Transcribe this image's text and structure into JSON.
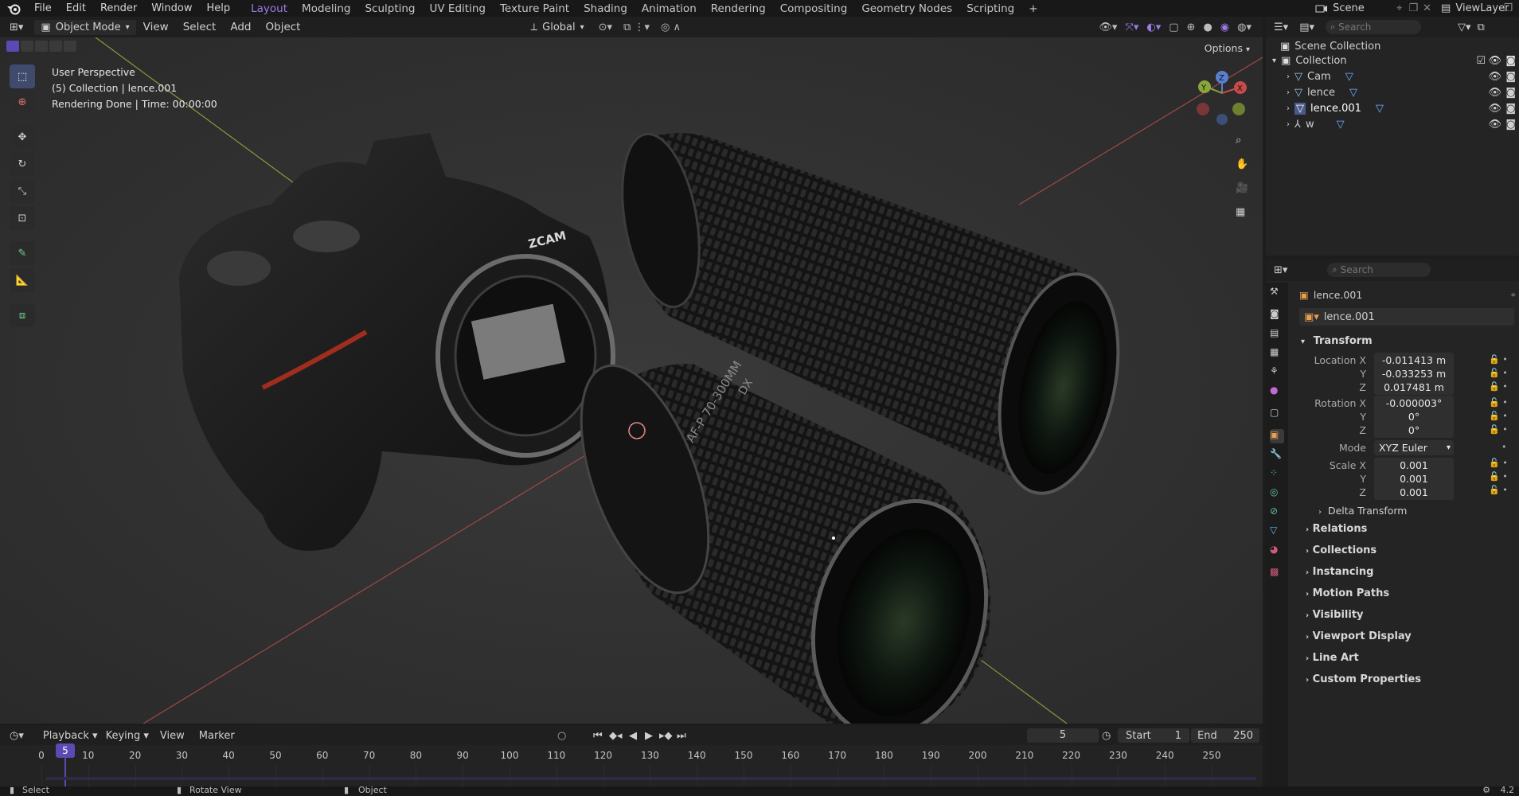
{
  "menu": [
    "File",
    "Edit",
    "Render",
    "Window",
    "Help"
  ],
  "workspaces": [
    "Layout",
    "Modeling",
    "Sculpting",
    "UV Editing",
    "Texture Paint",
    "Shading",
    "Animation",
    "Rendering",
    "Compositing",
    "Geometry Nodes",
    "Scripting",
    "+"
  ],
  "active_workspace": "Layout",
  "top_right": {
    "scene": "Scene",
    "view_layer": "ViewLayer"
  },
  "viewport_header": {
    "mode": "Object Mode",
    "menus": [
      "View",
      "Select",
      "Add",
      "Object"
    ],
    "orientation": "Global",
    "options": "Options"
  },
  "viewport_overlay": {
    "line1": "User Perspective",
    "line2": "(5) Collection | lence.001",
    "line3": "Rendering Done | Time: 00:00:00"
  },
  "gizmo": {
    "x": "X",
    "y": "Y",
    "z": "Z"
  },
  "lens_print": "AF-P 70-300MM",
  "lens_dx": "DX",
  "camera_brand": "ZCAM",
  "outliner": {
    "search_placeholder": "Search",
    "scene_collection": "Scene Collection",
    "collection": "Collection",
    "items": [
      "Cam",
      "lence",
      "lence.001",
      "w"
    ]
  },
  "properties": {
    "search_placeholder": "Search",
    "object_name": "lence.001",
    "object_datablock": "lence.001",
    "transform_header": "Transform",
    "location_label": "Location X",
    "location": [
      "-0.011413 m",
      "-0.033253 m",
      "0.017481 m"
    ],
    "rotation_label": "Rotation X",
    "rotation": [
      "-0.000003°",
      "0°",
      "0°"
    ],
    "mode_label": "Mode",
    "mode_value": "XYZ Euler",
    "scale_label": "Scale X",
    "scale": [
      "0.001",
      "0.001",
      "0.001"
    ],
    "axis_y": "Y",
    "axis_z": "Z",
    "delta_transform": "Delta Transform",
    "sections": [
      "Relations",
      "Collections",
      "Instancing",
      "Motion Paths",
      "Visibility",
      "Viewport Display",
      "Line Art",
      "Custom Properties"
    ]
  },
  "timeline": {
    "menus": [
      "Playback",
      "Keying",
      "View",
      "Marker"
    ],
    "current_frame": "5",
    "start_label": "Start",
    "start": "1",
    "end_label": "End",
    "end": "250",
    "ticks": [
      "0",
      "10",
      "20",
      "30",
      "40",
      "50",
      "60",
      "70",
      "80",
      "90",
      "100",
      "110",
      "120",
      "130",
      "140",
      "150",
      "160",
      "170",
      "180",
      "190",
      "200",
      "210",
      "220",
      "230",
      "240",
      "250"
    ],
    "playhead": "5"
  },
  "statusbar": {
    "select": "Select",
    "rotate": "Rotate View",
    "object": "Object",
    "version": "4.2"
  },
  "colors": {
    "accent": "#9b7be8",
    "active_tool": "#3f4a6d",
    "x_axis": "#c94a4a",
    "y_axis": "#8aa63a",
    "z_axis": "#5b7fd0"
  }
}
